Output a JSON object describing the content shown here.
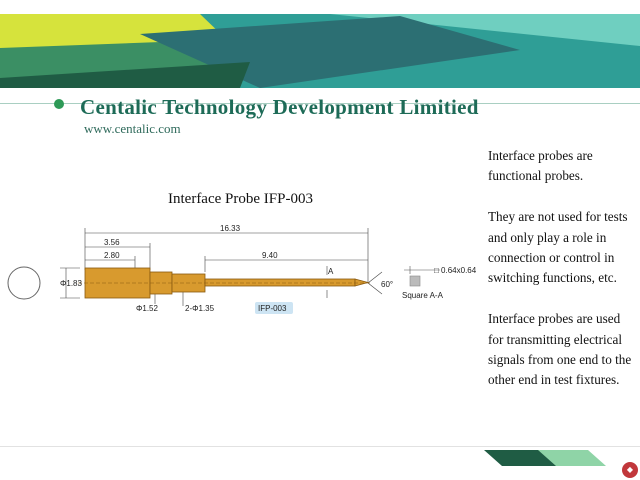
{
  "header": {
    "company_name": "Centalic Technology Development Limitied",
    "website": "www.centalic.com"
  },
  "drawing": {
    "title": "Interface Probe IFP-003",
    "dimensions": {
      "overall_length": "16.33",
      "len_356": "3.56",
      "len_280": "2.80",
      "len_940": "9.40",
      "diameter_183": "Φ1.83",
      "diameter_152": "Φ1.52",
      "diameter_135": "2-Φ1.35",
      "tip_angle": "60°",
      "section_marker": "A",
      "square_size": "□ 0.64x0.64",
      "square_label": "Square  A-A"
    },
    "part_label": "IFP-003"
  },
  "description": {
    "paragraphs": [
      "Interface probes are functional probes.",
      "They are not used for tests and only play a role in connection or control in switching functions, etc.",
      "Interface probes are used for transmitting electrical signals from one end to the other end in test fixtures."
    ]
  },
  "colors": {
    "brand_green": "#1d6b57",
    "accent_teal": "#35a6a0",
    "accent_yellow": "#d4e23b",
    "probe_gold": "#d89a2e"
  }
}
